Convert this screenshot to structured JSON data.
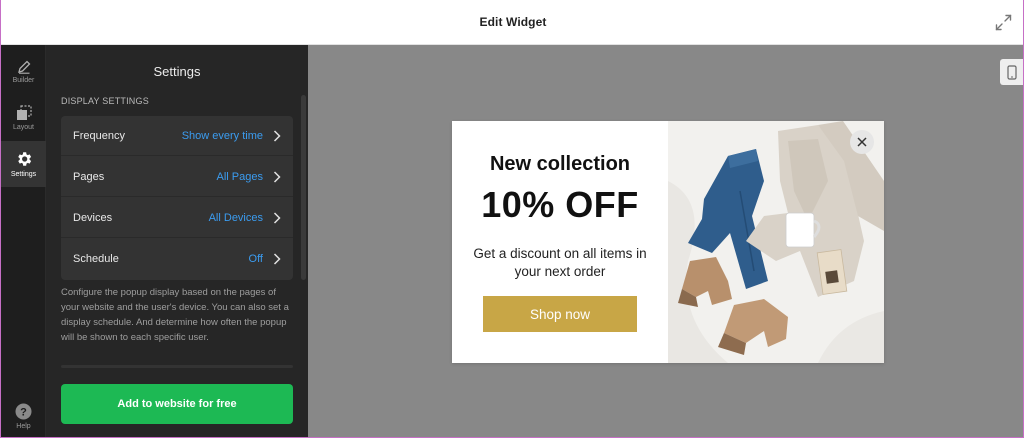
{
  "window": {
    "title": "Edit Widget",
    "expand_icon": "expand-arrows-icon"
  },
  "rail": {
    "items": [
      {
        "label": "Builder",
        "icon": "pencil-icon"
      },
      {
        "label": "Layout",
        "icon": "layout-icon"
      },
      {
        "label": "Settings",
        "icon": "gear-icon",
        "active": true
      }
    ],
    "help_label": "Help"
  },
  "panel": {
    "title": "Settings",
    "section_label": "DISPLAY SETTINGS",
    "rows": [
      {
        "name": "Frequency",
        "value": "Show every time"
      },
      {
        "name": "Pages",
        "value": "All Pages"
      },
      {
        "name": "Devices",
        "value": "All Devices"
      },
      {
        "name": "Schedule",
        "value": "Off"
      }
    ],
    "description": "Configure the popup display based on the pages of your website and the user's device. You can also set a display schedule. And determine how often the popup will be shown to each specific user.",
    "cta_label": "Add to website for free"
  },
  "popup": {
    "headline": "New collection",
    "discount": "10% OFF",
    "subtext": "Get a discount on all items in your next order",
    "button_label": "Shop now",
    "image": "flat-lay-clothing-photo"
  },
  "colors": {
    "accent_blue": "#3b9cf0",
    "cta_green": "#1db954",
    "shop_gold": "#c8a646"
  }
}
